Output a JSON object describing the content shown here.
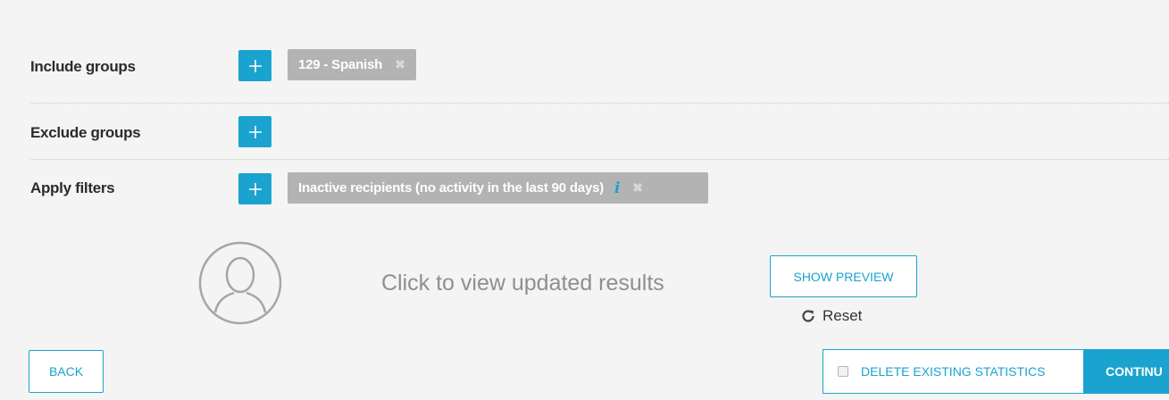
{
  "rows": {
    "include": {
      "label": "Include groups",
      "tags": [
        {
          "text": "129 - Spanish"
        }
      ]
    },
    "exclude": {
      "label": "Exclude groups",
      "tags": []
    },
    "filters": {
      "label": "Apply filters",
      "tags": [
        {
          "text": "Inactive recipients (no activity in the last 90 days)",
          "info_icon": "i"
        }
      ]
    }
  },
  "preview": {
    "message": "Click to view updated results",
    "show_preview_label": "SHOW PREVIEW",
    "reset_label": "Reset"
  },
  "footer": {
    "back_label": "BACK",
    "delete_stats_label": "DELETE EXISTING STATISTICS",
    "delete_stats_checked": false,
    "continue_label": "CONTINU"
  },
  "icons": {
    "add": "plus-icon",
    "remove": "close-icon",
    "info": "info-icon",
    "avatar": "user-avatar-icon",
    "reset": "refresh-icon"
  },
  "colors": {
    "accent": "#1ba3cf",
    "tag_bg": "#b3b3b3",
    "background": "#f4f4f4"
  }
}
